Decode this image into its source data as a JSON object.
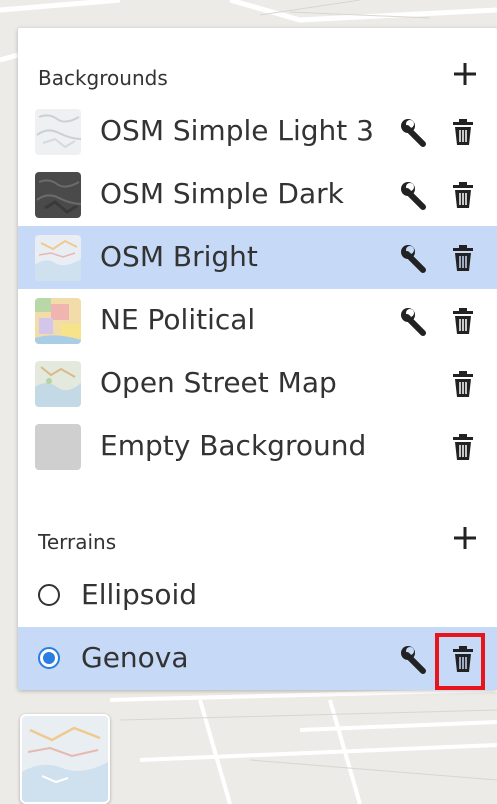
{
  "backgrounds": {
    "title": "Backgrounds",
    "add_icon": "plus-icon",
    "items": [
      {
        "label": "OSM Simple Light 3",
        "thumb_color": "#e6eaec",
        "has_wrench": true,
        "selected": false
      },
      {
        "label": "OSM Simple Dark",
        "thumb_color": "#4d4d4d",
        "has_wrench": true,
        "selected": false
      },
      {
        "label": "OSM Bright",
        "thumb_color": "#e3ecf3",
        "has_wrench": true,
        "selected": true
      },
      {
        "label": "NE Political",
        "thumb_color": "#f1dcae",
        "has_wrench": true,
        "selected": false
      },
      {
        "label": "Open Street Map",
        "thumb_color": "#dfe6df",
        "has_wrench": false,
        "selected": false
      },
      {
        "label": "Empty Background",
        "thumb_color": "#cfcfcf",
        "has_wrench": false,
        "selected": false
      }
    ]
  },
  "terrains": {
    "title": "Terrains",
    "add_icon": "plus-icon",
    "items": [
      {
        "label": "Ellipsoid",
        "checked": false,
        "has_wrench": false,
        "has_trash": false
      },
      {
        "label": "Genova",
        "checked": true,
        "has_wrench": true,
        "has_trash": true
      }
    ]
  },
  "colors": {
    "selected_row": "#c6daf8",
    "radio_accent": "#2a7de1",
    "highlight": "#e8141c"
  },
  "icons": {
    "wrench": "wrench-icon",
    "trash": "trash-icon",
    "add": "plus-icon"
  }
}
